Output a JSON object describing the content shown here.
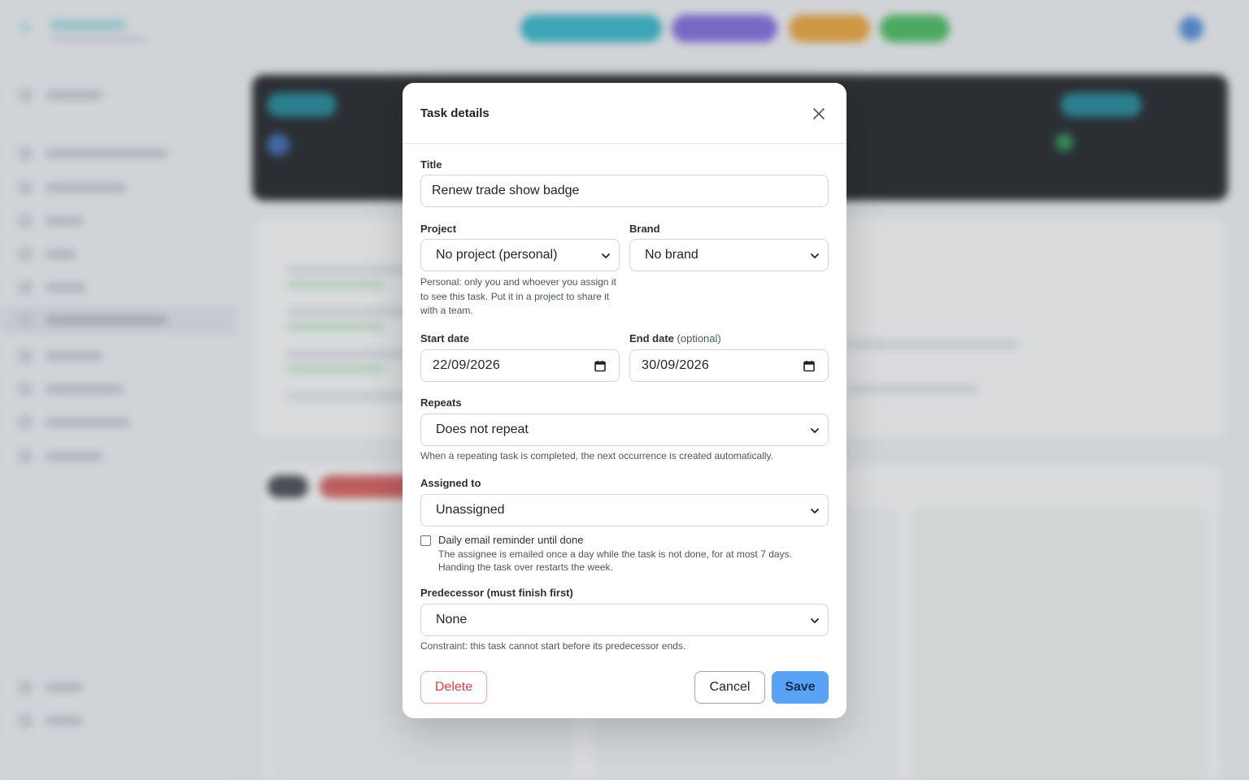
{
  "modal": {
    "title": "Task details",
    "title_label": "Title",
    "title_value": "Renew trade show badge",
    "project_label": "Project",
    "project_value": "No project (personal)",
    "project_help": "Personal: only you and whoever you assign it to see this task. Put it in a project to share it with a team.",
    "brand_label": "Brand",
    "brand_value": "No brand",
    "start_date_label": "Start date",
    "start_date_value": "22/09/2026",
    "end_date_label": "End date",
    "end_date_optional": "(optional)",
    "end_date_value": "30/09/2026",
    "repeats_label": "Repeats",
    "repeats_value": "Does not repeat",
    "repeats_help": "When a repeating task is completed, the next occurrence is created automatically.",
    "assigned_label": "Assigned to",
    "assigned_value": "Unassigned",
    "reminder_label": "Daily email reminder until done",
    "reminder_checked": false,
    "reminder_help": "The assignee is emailed once a day while the task is not done, for at most 7 days. Handing the task over restarts the week.",
    "predecessor_label": "Predecessor (must finish first)",
    "predecessor_value": "None",
    "predecessor_help": "Constraint: this task cannot start before its predecessor ends.",
    "delete_label": "Delete",
    "cancel_label": "Cancel",
    "save_label": "Save"
  },
  "icons": {
    "close": "close-icon",
    "chevron": "chevron-down-icon",
    "calendar": "calendar-icon"
  },
  "colors": {
    "save_button": "#5aa2f5",
    "delete_text": "#e03a46",
    "delete_border": "#f0a3a8",
    "background_dark_panel": "#0f1114",
    "pill_cyan": "#27b4c8",
    "pill_purple": "#7b5fe0",
    "pill_orange": "#f0a12a",
    "pill_green": "#3dba54"
  }
}
